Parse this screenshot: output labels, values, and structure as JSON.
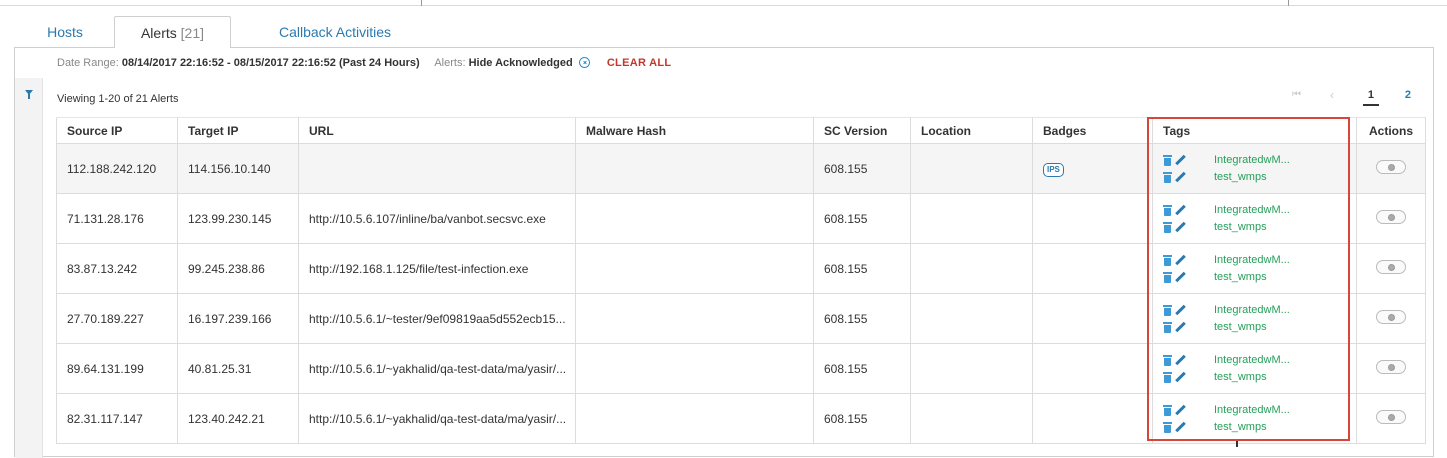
{
  "tabs": [
    {
      "label": "Hosts",
      "count": ""
    },
    {
      "label": "Alerts",
      "count": "[21]"
    },
    {
      "label": "Callback Activities",
      "count": ""
    }
  ],
  "filter": {
    "date_label": "Date Range:",
    "date_value": "08/14/2017 22:16:52 - 08/15/2017 22:16:52 (Past 24 Hours)",
    "alerts_label": "Alerts:",
    "alerts_value": "Hide Acknowledged",
    "clear_label": "CLEAR ALL"
  },
  "viewing": "Viewing 1-20 of 21 Alerts",
  "pager": {
    "first": "⏮",
    "prev": "‹",
    "page1": "1",
    "page2": "2"
  },
  "columns": [
    "Source IP",
    "Target IP",
    "URL",
    "Malware Hash",
    "SC Version",
    "Location",
    "Badges",
    "Tags",
    "Actions"
  ],
  "rows": [
    {
      "source_ip": "112.188.242.120",
      "target_ip": "114.156.10.140",
      "url": "",
      "hash": "",
      "sc_version": "608.155",
      "location": "",
      "badge": "IPS",
      "tags": [
        "IntegratedwM...",
        "test_wmps"
      ]
    },
    {
      "source_ip": "71.131.28.176",
      "target_ip": "123.99.230.145",
      "url": "http://10.5.6.107/inline/ba/vanbot.secsvc.exe",
      "hash": "",
      "sc_version": "608.155",
      "location": "",
      "badge": "",
      "tags": [
        "IntegratedwM...",
        "test_wmps"
      ]
    },
    {
      "source_ip": "83.87.13.242",
      "target_ip": "99.245.238.86",
      "url": "http://192.168.1.125/file/test-infection.exe",
      "hash": "",
      "sc_version": "608.155",
      "location": "",
      "badge": "",
      "tags": [
        "IntegratedwM...",
        "test_wmps"
      ]
    },
    {
      "source_ip": "27.70.189.227",
      "target_ip": "16.197.239.166",
      "url": "http://10.5.6.1/~tester/9ef09819aa5d552ecb15...",
      "hash": "",
      "sc_version": "608.155",
      "location": "",
      "badge": "",
      "tags": [
        "IntegratedwM...",
        "test_wmps"
      ]
    },
    {
      "source_ip": "89.64.131.199",
      "target_ip": "40.81.25.31",
      "url": "http://10.5.6.1/~yakhalid/qa-test-data/ma/yasir/...",
      "hash": "",
      "sc_version": "608.155",
      "location": "",
      "badge": "",
      "tags": [
        "IntegratedwM...",
        "test_wmps"
      ]
    },
    {
      "source_ip": "82.31.117.147",
      "target_ip": "123.40.242.21",
      "url": "http://10.5.6.1/~yakhalid/qa-test-data/ma/yasir/...",
      "hash": "",
      "sc_version": "608.155",
      "location": "",
      "badge": "",
      "tags": [
        "IntegratedwM...",
        "test_wmps"
      ]
    }
  ],
  "colors": {
    "link": "#2a7ab0",
    "tag": "#27a05b",
    "clear": "#c0392b",
    "highlight": "#d9453b"
  },
  "icons": {
    "filter": "funnel-icon",
    "delete": "trash-icon",
    "edit": "pencil-icon",
    "actions": "gear-icon",
    "clear_filter": "x-icon"
  }
}
